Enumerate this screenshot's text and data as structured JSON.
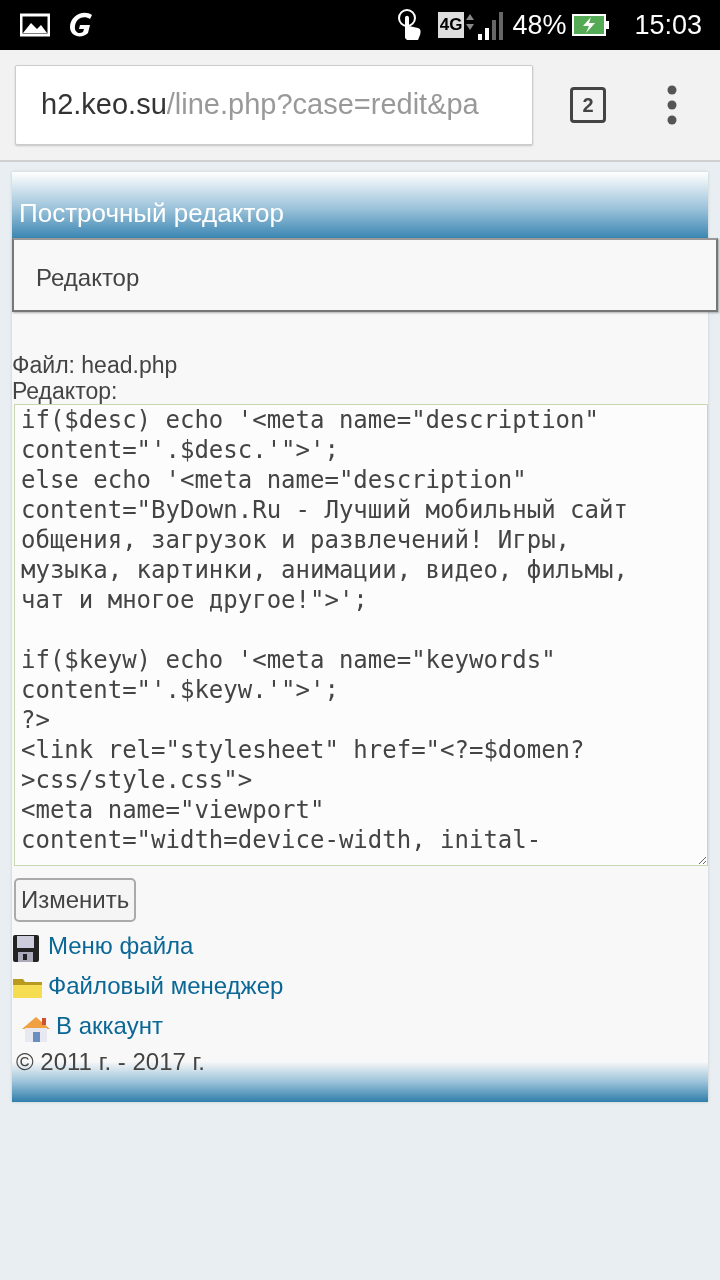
{
  "status_bar": {
    "battery": "48%",
    "time": "15:03",
    "network": "4G"
  },
  "browser": {
    "url_host": "h2.keo.su",
    "url_path": "/line.php?case=redit&pa",
    "tab_count": "2"
  },
  "header": {
    "title": "Построчный редактор"
  },
  "section": {
    "title": "Редактор"
  },
  "file_label": "Файл: head.php",
  "editor_label": "Редактор:",
  "editor": {
    "value": "if($desc) echo '<meta name=\"description\"\ncontent=\"'.$desc.'\">';\nelse echo '<meta name=\"description\"\ncontent=\"ByDown.Ru - Лучший мобильный сайт\nобщения, загрузок и развлечений! Игры,\nмузыка, картинки, анимации, видео, фильмы,\nчат и многое другое!\">';\n\nif($keyw) echo '<meta name=\"keywords\"\ncontent=\"'.$keyw.'\">';\n?>\n<link rel=\"stylesheet\" href=\"<?=$domen?\n>css/style.css\">\n<meta name=\"viewport\"\ncontent=\"width=device-width, inital-"
  },
  "submit_button": "Изменить",
  "links": [
    {
      "kind": "floppy",
      "label": "Меню файла"
    },
    {
      "kind": "folder",
      "label": "Файловый менеджер"
    },
    {
      "kind": "home",
      "label": "В аккаунт"
    }
  ],
  "footer": "© 2011 г. - 2017 г."
}
